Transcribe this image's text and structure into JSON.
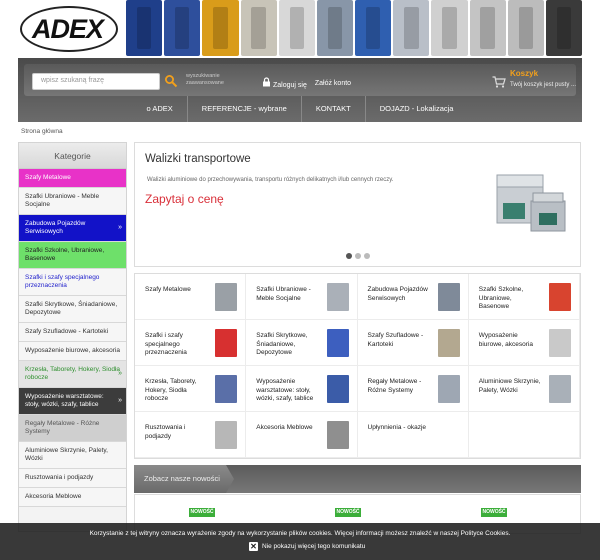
{
  "header": {
    "logo_text": "ADEX",
    "products": [
      {
        "name": "workbench-photo",
        "color": "#1f3f8a"
      },
      {
        "name": "tool-cabinet-photo",
        "color": "#2e4f9c"
      },
      {
        "name": "locker-photo",
        "color": "#d99c1a"
      },
      {
        "name": "cabinet-grey-photo",
        "color": "#c8c4b8"
      },
      {
        "name": "cabinet-white-photo",
        "color": "#d8d8d8"
      },
      {
        "name": "van-interior-photo",
        "color": "#8896a8"
      },
      {
        "name": "locker-blue-photo",
        "color": "#2f5fb0"
      },
      {
        "name": "shelving-photo",
        "color": "#b9bfc8"
      },
      {
        "name": "lock-photo",
        "color": "#d0d0d0"
      },
      {
        "name": "cam-lock-photo",
        "color": "#c4c4c4"
      },
      {
        "name": "keys-photo",
        "color": "#bcbcbc"
      },
      {
        "name": "van-shelving-photo",
        "color": "#3a3a3a"
      }
    ]
  },
  "search": {
    "placeholder": "wpisz szukaną frazę",
    "advanced": "wyszukiwanie zaawansowane"
  },
  "account": {
    "login": "Zaloguj się",
    "register": "Załóż konto"
  },
  "cart": {
    "title": "Koszyk",
    "status": "Twój koszyk jest pusty ..."
  },
  "nav": [
    "o ADEX",
    "REFERENCJE - wybrane",
    "KONTAKT",
    "DOJAZD - Lokalizacja"
  ],
  "breadcrumb": "Strona główna",
  "sidebar": {
    "title": "Kategorie",
    "items": [
      {
        "label": "Szafy Metalowe",
        "bg": "#e832c8",
        "fg": "#ffffff",
        "chevron": false
      },
      {
        "label": "Szafki Ubraniowe - Meble Socjalne",
        "bg": "#f6f6f6",
        "fg": "#333333",
        "chevron": false
      },
      {
        "label": "Zabudowa Pojazdów Serwisowych",
        "bg": "#1212c8",
        "fg": "#ffffff",
        "chevron": true
      },
      {
        "label": "Szafki Szkolne, Ubraniowe, Basenowe",
        "bg": "#6ee06a",
        "fg": "#222222",
        "chevron": false
      },
      {
        "label": "Szafki i szafy specjalnego przeznaczenia",
        "bg": "#f6f6f6",
        "fg": "#2222cc",
        "chevron": false
      },
      {
        "label": "Szafki Skrytkowe, Śniadaniowe, Depozytowe",
        "bg": "#f6f6f6",
        "fg": "#333333",
        "chevron": false
      },
      {
        "label": "Szafy Szufladowe - Kartoteki",
        "bg": "#f6f6f6",
        "fg": "#333333",
        "chevron": false
      },
      {
        "label": "Wyposażenie biurowe, akcesoria",
        "bg": "#f6f6f6",
        "fg": "#333333",
        "chevron": false
      },
      {
        "label": "Krzesła, Taborety, Hokery, Siodła robocze",
        "bg": "#e4e4e4",
        "fg": "#2e8f2e",
        "chevron": true
      },
      {
        "label": "Wyposażenie warsztatowe: stoły, wózki, szafy, tablice",
        "bg": "#3c3c3c",
        "fg": "#ffffff",
        "chevron": true
      },
      {
        "label": "Regały Metalowe - Różne Systemy",
        "bg": "#cfcfcf",
        "fg": "#555555",
        "chevron": false
      },
      {
        "label": "Aluminiowe Skrzynie, Palety, Wózki",
        "bg": "#f6f6f6",
        "fg": "#333333",
        "chevron": false
      },
      {
        "label": "Rusztowania i podjazdy",
        "bg": "#f6f6f6",
        "fg": "#333333",
        "chevron": false
      },
      {
        "label": "Akcesoria Meblowe",
        "bg": "#f6f6f6",
        "fg": "#333333",
        "chevron": false
      }
    ]
  },
  "hero": {
    "title": "Walizki transportowe",
    "desc": "Walizki aluminiowe do przechowywania, transportu różnych delikatnych i/lub cennych rzeczy.",
    "cta": "Zapytaj o cenę"
  },
  "categories": [
    {
      "label": "Szafy Metalowe",
      "color": "#9aa0a6"
    },
    {
      "label": "Szafki Ubraniowe - Meble Socjalne",
      "color": "#aab0b8"
    },
    {
      "label": "Zabudowa Pojazdów Serwisowych",
      "color": "#7f8a99"
    },
    {
      "label": "Szafki Szkolne, Ubraniowe, Basenowe",
      "color": "#d8442f"
    },
    {
      "label": "Szafki i szafy specjalnego przeznaczenia",
      "color": "#d73030"
    },
    {
      "label": "Szafki Skrytkowe, Śniadaniowe, Depozytowe",
      "color": "#3d5fbf"
    },
    {
      "label": "Szafy Szufladowe - Kartoteki",
      "color": "#b3a890"
    },
    {
      "label": "Wyposażenie biurowe, akcesoria",
      "color": "#c9c9c9"
    },
    {
      "label": "Krzesła, Taborety, Hokery, Siodła robocze",
      "color": "#5a6fa8"
    },
    {
      "label": "Wyposażenie warsztatowe: stoły, wózki, szafy, tablice",
      "color": "#3b5ca8"
    },
    {
      "label": "Regały Metalowe - Różne Systemy",
      "color": "#9ea7b3"
    },
    {
      "label": "Aluminiowe Skrzynie, Palety, Wózki",
      "color": "#a9b0b8"
    },
    {
      "label": "Rusztowania i podjazdy",
      "color": "#b7b7b7"
    },
    {
      "label": "Akcesoria Meblowe",
      "color": "#8f8f8f"
    },
    {
      "label": "Upłynnienia - okazje",
      "color": null
    }
  ],
  "new_products": {
    "heading": "Zobacz nasze nowości",
    "badges": [
      "NOWOŚĆ",
      "NOWOŚĆ",
      "NOWOŚĆ"
    ]
  },
  "cookie": {
    "text": "Korzystanie z tej witryny oznacza wyrażenie zgody na wykorzystanie plików cookies. Więcej informacji możesz znaleźć w naszej Polityce Cookies.",
    "dismiss": "Nie pokazuj więcej tego komunikatu"
  }
}
